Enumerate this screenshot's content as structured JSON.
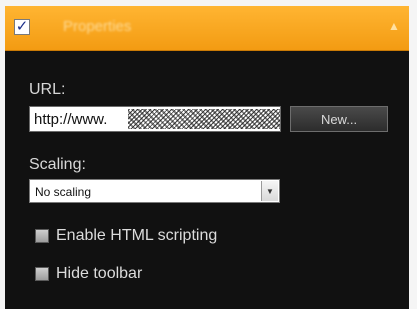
{
  "header": {
    "title": "Properties",
    "enabled_check": "✓",
    "collapse_glyph": "▲"
  },
  "url": {
    "label": "URL:",
    "value": "http://www.",
    "new_button_label": "New..."
  },
  "scaling": {
    "label": "Scaling:",
    "selected": "No scaling",
    "arrow_glyph": "▼"
  },
  "options": {
    "html_scripting_label": "Enable HTML scripting",
    "html_scripting_checked": false,
    "hide_toolbar_label": "Hide toolbar",
    "hide_toolbar_checked": false
  },
  "colors": {
    "header_orange": "#f5a21c",
    "panel_bg": "#111111",
    "text": "#d8d8d8"
  }
}
